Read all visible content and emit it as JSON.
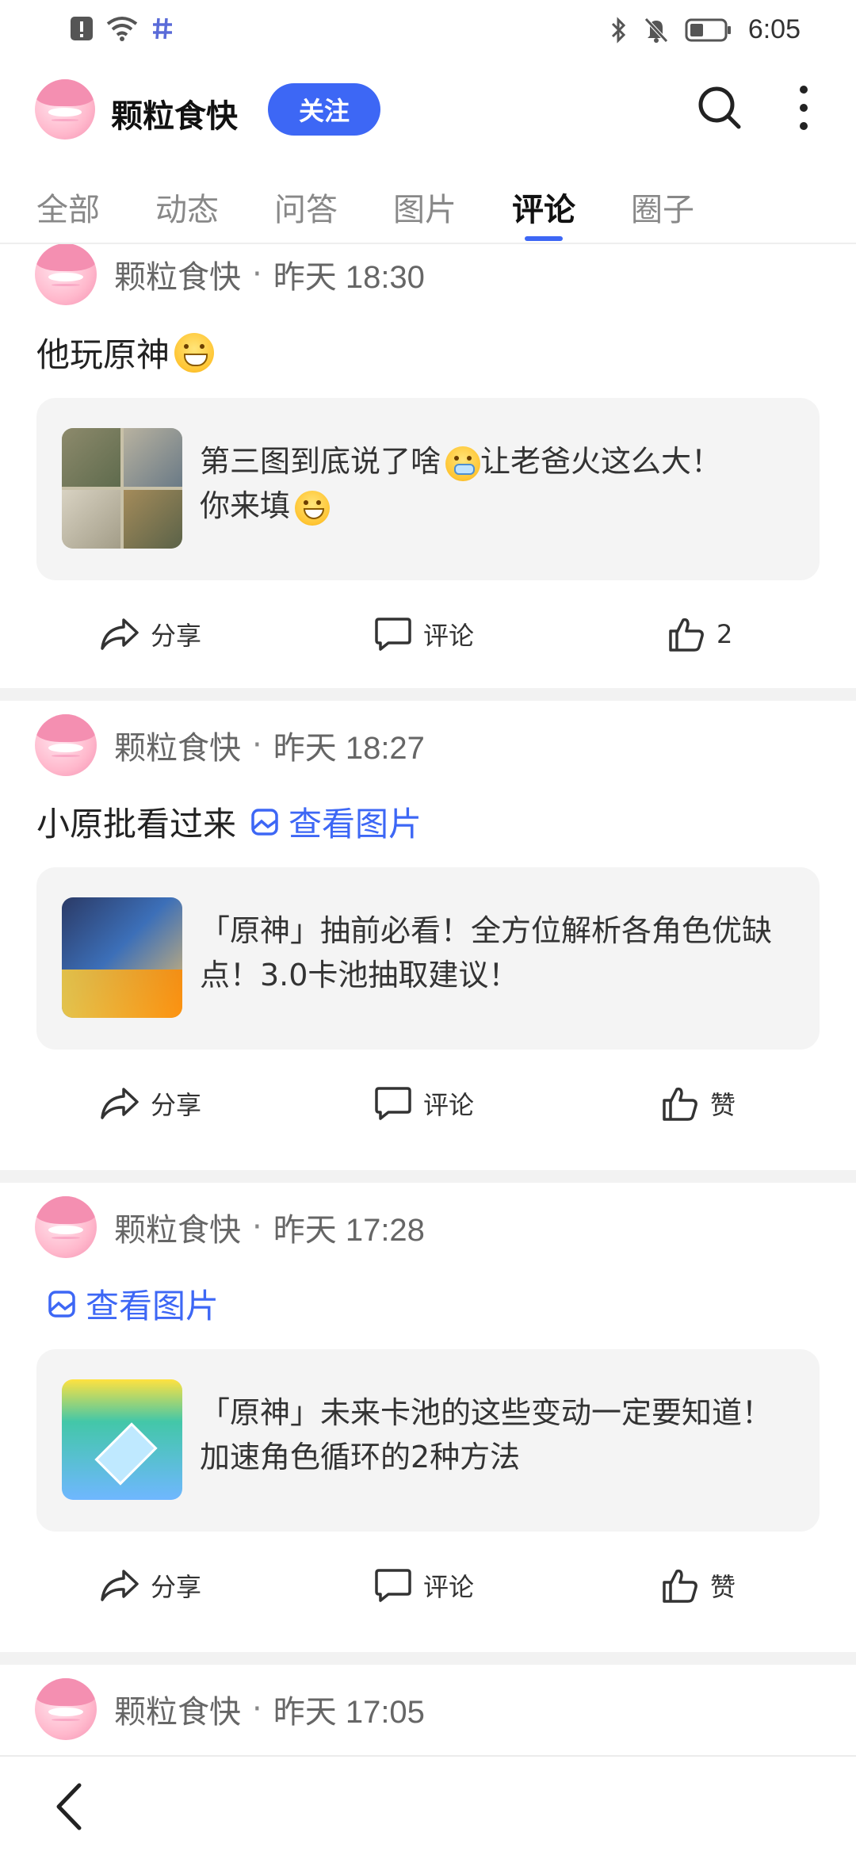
{
  "status_bar": {
    "time": "6:05"
  },
  "header": {
    "name": "颗粒食快",
    "follow_label": "关注"
  },
  "tabs": [
    {
      "label": "全部"
    },
    {
      "label": "动态"
    },
    {
      "label": "问答"
    },
    {
      "label": "图片"
    },
    {
      "label": "评论"
    },
    {
      "label": "圈子"
    }
  ],
  "active_tab": "评论",
  "posts": [
    {
      "author": "颗粒食快",
      "time": "昨天 18:30",
      "text": "他玩原神",
      "view_image": "",
      "card_text_1": "第三图到底说了啥",
      "card_text_2": "让老爸火这么大！",
      "card_text_3": "你来填",
      "share": "分享",
      "comment": "评论",
      "like": "2"
    },
    {
      "author": "颗粒食快",
      "time": "昨天 18:27",
      "text": "小原批看过来",
      "view_image": "查看图片",
      "card_text": "「原神」抽前必看！全方位解析各角色优缺点！3.0卡池抽取建议！",
      "share": "分享",
      "comment": "评论",
      "like": "赞"
    },
    {
      "author": "颗粒食快",
      "time": "昨天 17:28",
      "text": "",
      "view_image": "查看图片",
      "card_text": "「原神」未来卡池的这些变动一定要知道！加速角色循环的2种方法",
      "share": "分享",
      "comment": "评论",
      "like": "赞"
    },
    {
      "author": "颗粒食快",
      "time": "昨天 17:05"
    }
  ],
  "colors": {
    "accent": "#3d67f5",
    "card_bg": "#f4f4f4"
  }
}
